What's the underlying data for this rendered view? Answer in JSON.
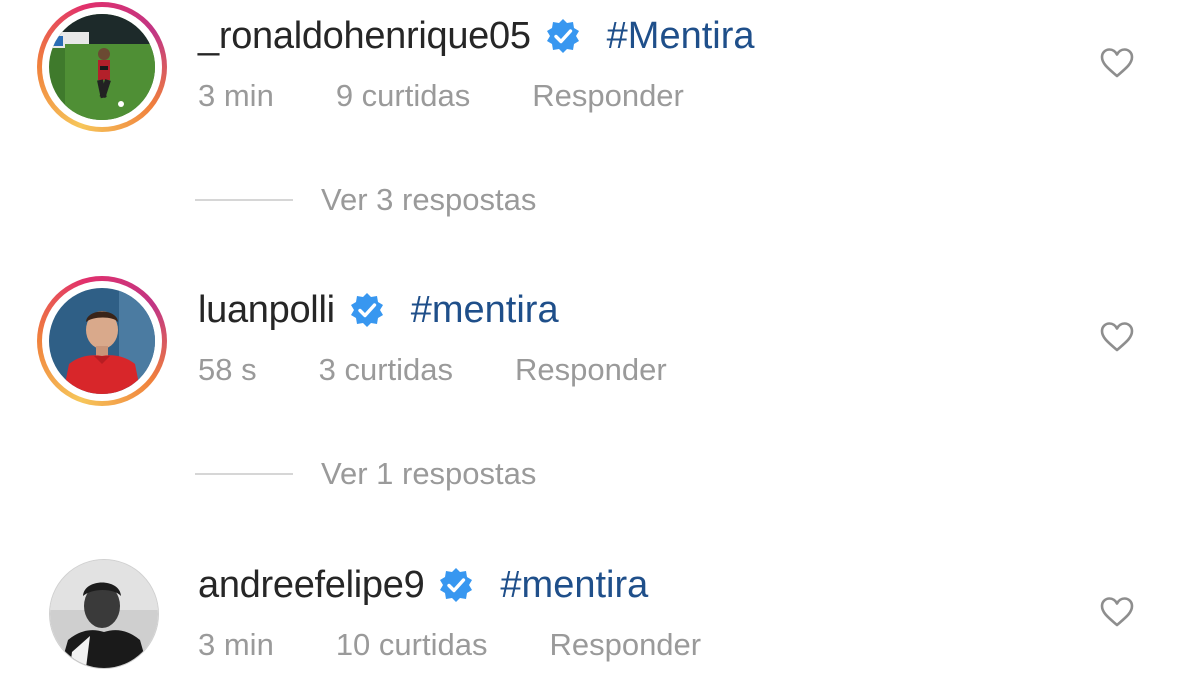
{
  "comments": [
    {
      "username": "_ronaldohenrique05",
      "verified": true,
      "text": "#Mentira",
      "time": "3 min",
      "likes": "9 curtidas",
      "reply_label": "Responder",
      "avatar_icon": "player-photo-avatar",
      "has_story_ring": true,
      "view_replies": "Ver 3 respostas"
    },
    {
      "username": "luanpolli",
      "verified": true,
      "text": "#mentira",
      "time": "58 s",
      "likes": "3 curtidas",
      "reply_label": "Responder",
      "avatar_icon": "player-photo-avatar",
      "has_story_ring": true,
      "view_replies": "Ver 1 respostas"
    },
    {
      "username": "andreefelipe9",
      "verified": true,
      "text": "#mentira",
      "time": "3 min",
      "likes": "10 curtidas",
      "reply_label": "Responder",
      "avatar_icon": "grayscale-photo-avatar",
      "has_story_ring": false
    }
  ],
  "colors": {
    "username": "#262626",
    "hashtag": "#1f4f8a",
    "meta": "#9a9a9a",
    "verified_badge": "#3897f0",
    "heart_outline": "#8e8e8e",
    "divider": "#d6d6d6"
  },
  "icons": {
    "verified": "verified-badge-icon",
    "like": "heart-outline-icon"
  }
}
